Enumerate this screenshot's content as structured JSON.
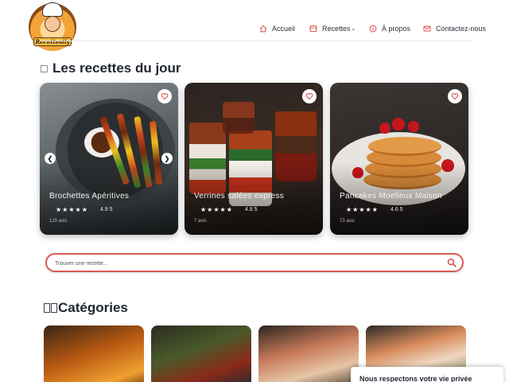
{
  "brand": {
    "logo_text": "Recettesily"
  },
  "nav": {
    "accueil": "Accueil",
    "recettes": "Recettes",
    "apropos": "À propos",
    "contact": "Contactez-nous"
  },
  "sections": {
    "day_title": "Les recettes du jour",
    "categories_title": "Catégories"
  },
  "recipes": [
    {
      "title": "Brochettes Apéritives",
      "stars": "★★★★★",
      "rating": "4.9 5",
      "reviews": "129 avis"
    },
    {
      "title": "Verrines salées express",
      "stars": "★★★★★",
      "rating": "4.8 5",
      "reviews": "7 avis"
    },
    {
      "title": "Pancakes Moelleux Maison",
      "stars": "★★★★★",
      "rating": "4.6 5",
      "reviews": "73 avis"
    }
  ],
  "search": {
    "placeholder": "Trouver une recette..."
  },
  "privacy": {
    "text": "Nous respectons votre vie privée"
  },
  "icons": {
    "home": "home-icon",
    "recettes": "book-icon",
    "apropos": "info-icon",
    "contact": "mail-icon",
    "favorite": "heart-icon",
    "search": "search-icon",
    "prev": "chevron-left-icon",
    "next": "chevron-right-icon"
  },
  "colors": {
    "accent": "#d95a50",
    "text": "#1f2430"
  }
}
